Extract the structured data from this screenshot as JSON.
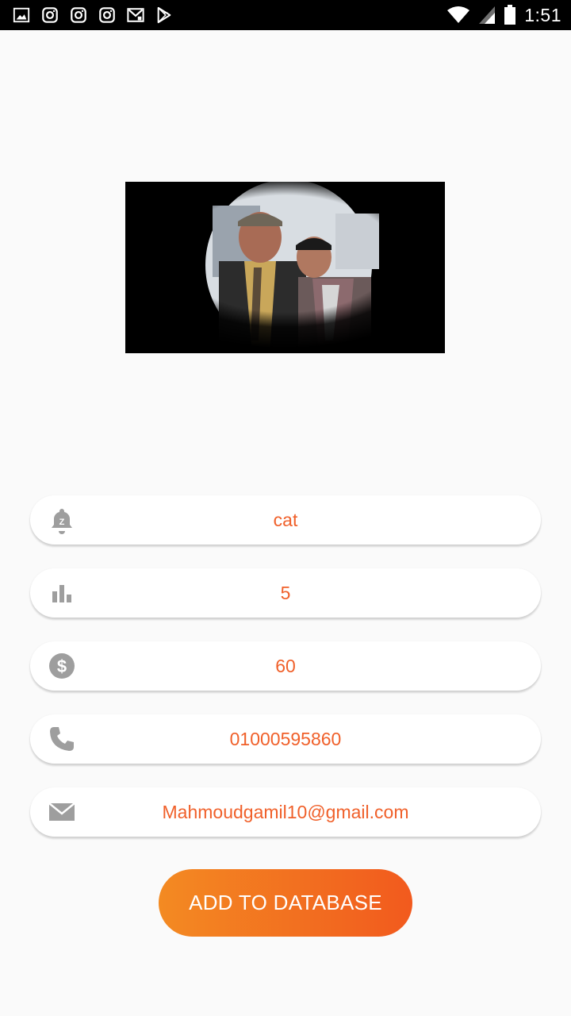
{
  "status_bar": {
    "time": "1:51",
    "left_icons": [
      "gallery-icon",
      "instagram-icon",
      "instagram-icon",
      "instagram-icon",
      "gmail-icon",
      "play-store-icon"
    ],
    "right_icons": [
      "wifi-icon",
      "signal-icon",
      "battery-icon"
    ]
  },
  "photo": {
    "description_icon": "photo-image"
  },
  "form": {
    "fields": [
      {
        "icon": "bell-z-icon",
        "value": "cat"
      },
      {
        "icon": "bar-chart-icon",
        "value": "5"
      },
      {
        "icon": "dollar-icon",
        "value": "60"
      },
      {
        "icon": "phone-icon",
        "value": "01000595860"
      },
      {
        "icon": "mail-icon",
        "value": "Mahmoudgamil10@gmail.com"
      }
    ],
    "submit_label": "ADD TO DATABASE"
  },
  "colors": {
    "accent_text": "#f0602a",
    "button_gradient_start": "#f38a22",
    "button_gradient_end": "#f25a1e",
    "icon_gray": "#9e9e9e",
    "background": "#fafafa"
  }
}
